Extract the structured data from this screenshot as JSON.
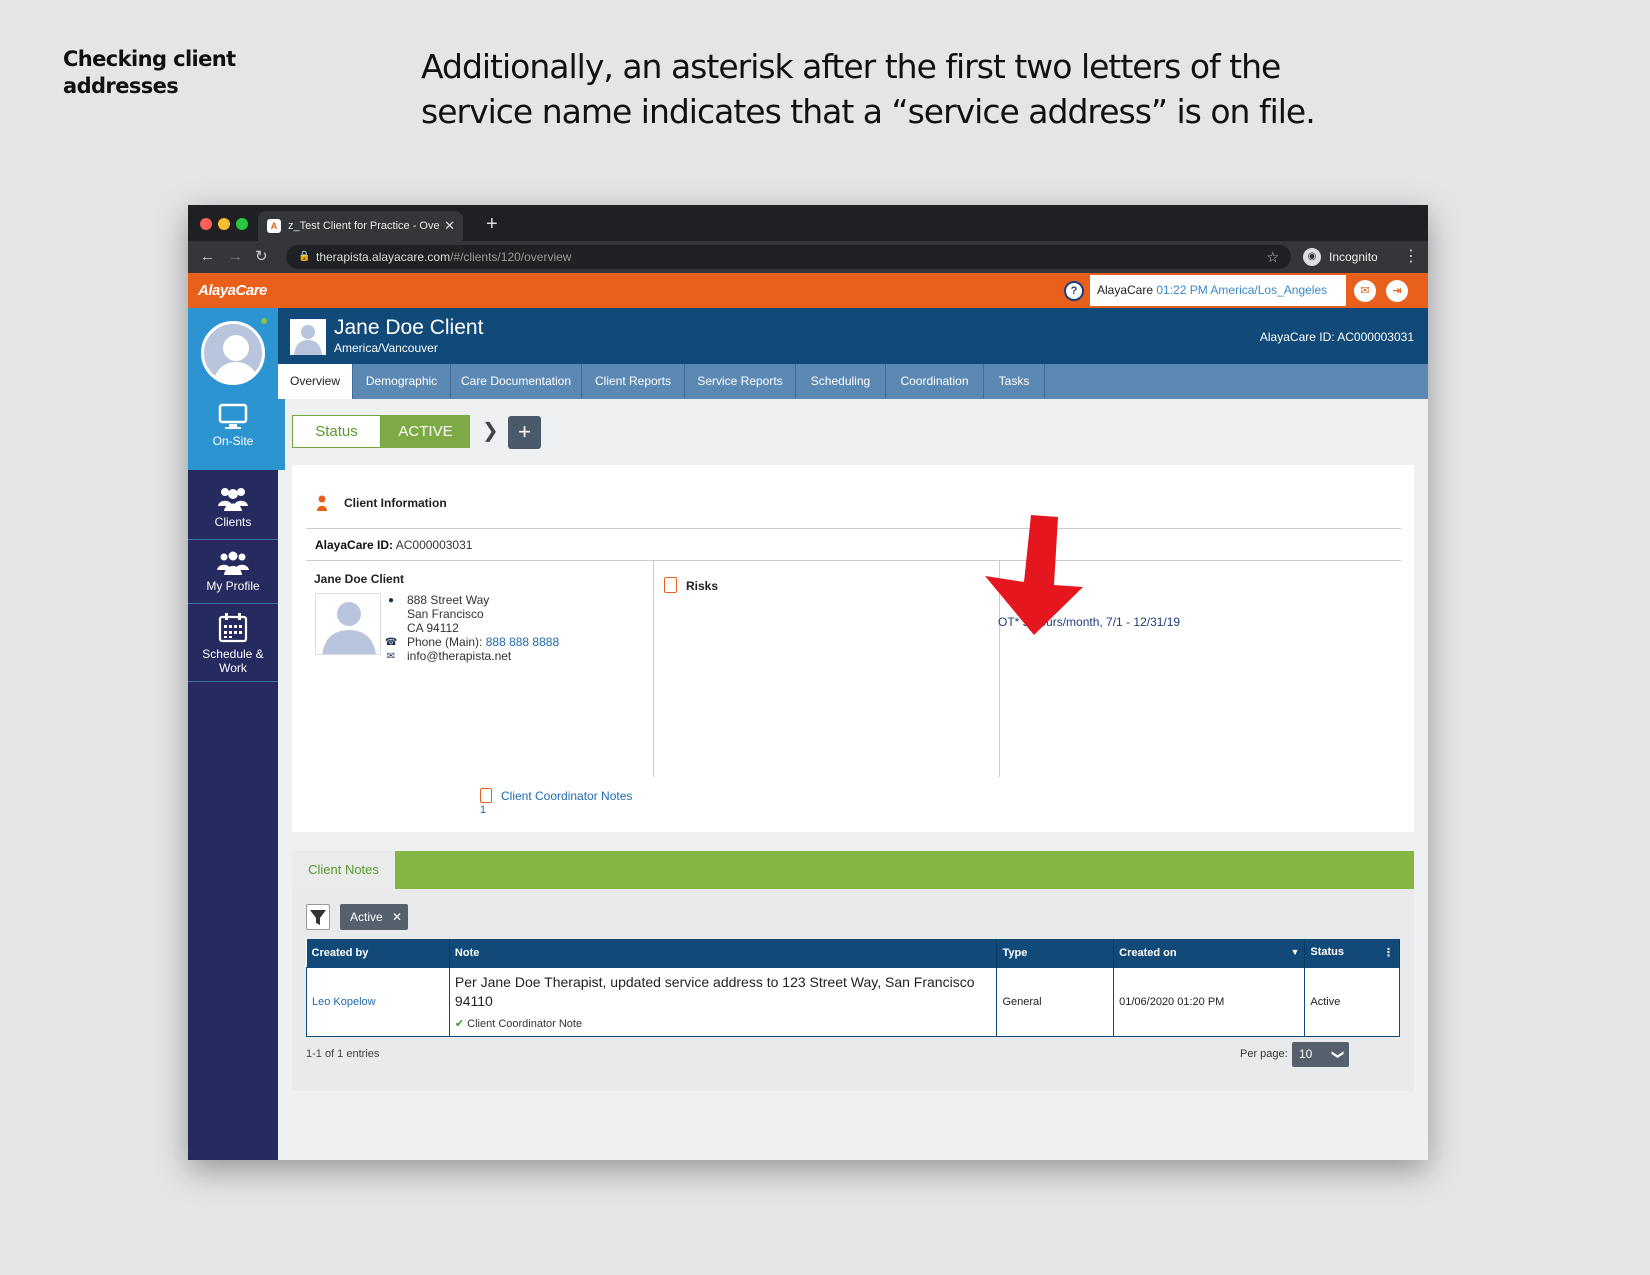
{
  "slide": {
    "label": "Checking client addresses",
    "caption": "Additionally, an asterisk after the first two letters of the service name indicates that a “service address” is on file."
  },
  "browser": {
    "tab_title": "z_Test Client for Practice - Ove",
    "url_host": "therapista.alayacare.com",
    "url_path": "/#/clients/120/overview",
    "incognito_label": "Incognito"
  },
  "topbar": {
    "logo": "AlayaCare",
    "user": "AlayaCare",
    "time": "01:22 PM America/Los_Angeles"
  },
  "sidebar": {
    "items": [
      {
        "label": "On-Site",
        "icon": "monitor-icon"
      },
      {
        "label": "Clients",
        "icon": "clients-icon"
      },
      {
        "label": "My Profile",
        "icon": "profile-icon"
      },
      {
        "label": "Schedule &",
        "label2": "Work",
        "icon": "calendar-icon"
      }
    ]
  },
  "header": {
    "name": "Jane Doe Client",
    "timezone": "America/Vancouver",
    "alayacare_id": "AlayaCare ID: AC000003031"
  },
  "tabs": [
    {
      "label": "Overview",
      "active": true
    },
    {
      "label": "Demographic"
    },
    {
      "label": "Care Documentation"
    },
    {
      "label": "Client Reports"
    },
    {
      "label": "Service Reports"
    },
    {
      "label": "Scheduling"
    },
    {
      "label": "Coordination"
    },
    {
      "label": "Tasks"
    }
  ],
  "status": {
    "label": "Status",
    "value": "ACTIVE"
  },
  "client_info": {
    "title": "Client Information",
    "id_label": "AlayaCare ID:",
    "id_value": "AC000003031",
    "name": "Jane Doe Client",
    "address1": "888 Street Way",
    "address2": "San Francisco",
    "address3": "CA 94112",
    "phone_label": "Phone (Main):",
    "phone": "888 888 8888",
    "email": "info@therapista.net",
    "risks_label": "Risks",
    "services_label": "es",
    "service_line": "OT* 5 hours/month, 7/1 - 12/31/19",
    "coordinator_notes_label": "Client Coordinator Notes",
    "coordinator_notes_count": "1"
  },
  "notes": {
    "tab_label": "Client Notes",
    "filter_chip": "Active",
    "columns": [
      "Created by",
      "Note",
      "Type",
      "Created on",
      "Status"
    ],
    "rows": [
      {
        "created_by": "Leo Kopelow",
        "note": "Per Jane Doe Therapist, updated service address to 123 Street Way, San Francisco 94110",
        "note_type_tag": "Client Coordinator Note",
        "type": "General",
        "created_on": "01/06/2020 01:20 PM",
        "status": "Active"
      }
    ],
    "entries": "1-1 of 1 entries",
    "per_page_label": "Per page:",
    "per_page": "10"
  },
  "colors": {
    "orange": "#e8601c",
    "navy": "#114a78",
    "sidebar": "#262a5e",
    "green": "#86b642",
    "arrow_red": "#e5161d"
  }
}
